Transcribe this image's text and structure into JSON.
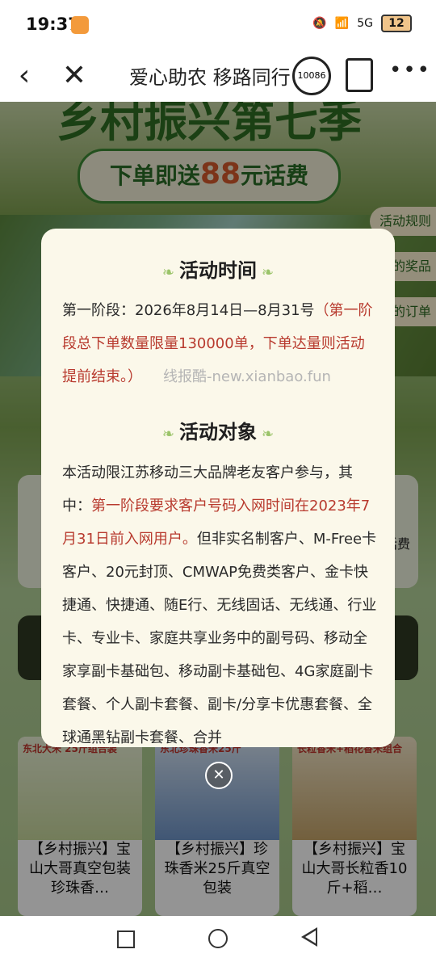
{
  "status": {
    "time": "19:37",
    "network": "5G",
    "battery": "12"
  },
  "nav": {
    "title": "爱心助农 移路同行",
    "phone_badge": "10086"
  },
  "hero": {
    "title": "乡村振兴第七季",
    "banner_prefix": "下单即送",
    "banner_amount": "88",
    "banner_suffix": "元话费"
  },
  "side_buttons": [
    "活动规则",
    "我的奖品",
    "我的订单"
  ],
  "behind_card_text": "话费",
  "products": [
    {
      "tag": "东北大米 25斤组合装",
      "name": "【乡村振兴】宝山大哥真空包装珍珠香…"
    },
    {
      "tag": "东北珍珠香米25斤",
      "name": "【乡村振兴】珍珠香米25斤真空包装"
    },
    {
      "tag": "长粒香米+稻花香米组合",
      "name": "【乡村振兴】宝山大哥长粒香10斤+稻…"
    }
  ],
  "modal": {
    "time_title": "活动时间",
    "time_text": "第一阶段：2026年8月14日—8月31号",
    "time_note": "（第一阶段总下单数量限量130000单，下单达量则活动提前结束。）",
    "watermark": "线报酷-new.xianbao.fun",
    "target_title": "活动对象",
    "target_text_1": "本活动限江苏移动三大品牌老友客户参与，其中：",
    "target_red": "第一阶段要求客户号码入网时间在2023年7月31日前入网用户。",
    "target_text_2": "但非实名制客户、M-Free卡客户、20元封顶、CMWAP免费类客户、金卡快捷通、快捷通、随E行、无线固话、无线通、行业卡、专业卡、家庭共享业务中的副号码、移动全家享副卡基础包、移动副卡基础包、4G家庭副卡套餐、个人副卡套餐、副卡/分享卡优惠套餐、全球通黑钻副卡套餐、合并"
  },
  "colors": {
    "accent_green": "#2f6e23",
    "note_red": "#b83a2e",
    "modal_bg": "#fbf8ea"
  }
}
